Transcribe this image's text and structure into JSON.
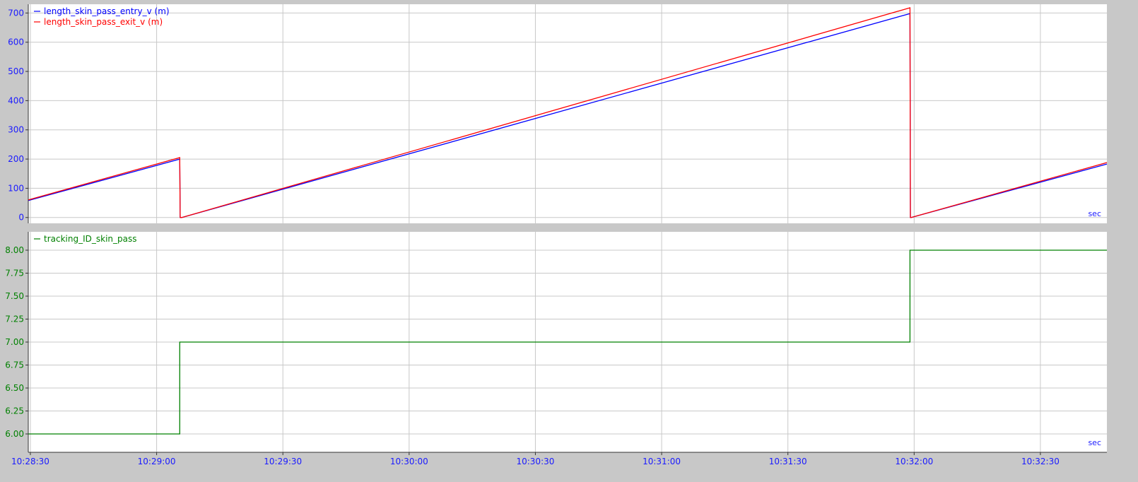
{
  "colors": {
    "background": "#c8c8c8",
    "plot_bg": "#ffffff",
    "grid": "#c8c8c8",
    "axis_text": "#1a1aff",
    "entry_series": "#0000ff",
    "exit_series": "#ff0000",
    "tracking_series": "#008000"
  },
  "x_axis": {
    "tick_labels": [
      "10:28:30",
      "10:29:00",
      "10:29:30",
      "10:30:00",
      "10:30:30",
      "10:31:00",
      "10:31:30",
      "10:32:00",
      "10:32:30"
    ],
    "tick_seconds": [
      0,
      30,
      60,
      90,
      120,
      150,
      180,
      210,
      240
    ],
    "range_seconds": [
      -0.5,
      255.8
    ],
    "unit_label": "sec"
  },
  "chart_data": [
    {
      "type": "line",
      "ylim": [
        -20,
        730
      ],
      "yticks": [
        0,
        100,
        200,
        300,
        400,
        500,
        600,
        700
      ],
      "ytick_labels": [
        "0",
        "100",
        "200",
        "300",
        "400",
        "500",
        "600",
        "700"
      ],
      "unit_label": "sec",
      "grid": true,
      "legend_position": "top-left",
      "series": [
        {
          "name": "length_skin_pass_entry_v (m)",
          "color": "#0000ff",
          "points": [
            [
              -0.5,
              58
            ],
            [
              35.5,
              200
            ],
            [
              35.6,
              0
            ],
            [
              36.0,
              0
            ],
            [
              209.0,
              698
            ],
            [
              209.1,
              0
            ],
            [
              209.3,
              0
            ],
            [
              255.8,
              183
            ]
          ]
        },
        {
          "name": "length_skin_pass_exit_v (m)",
          "color": "#ff0000",
          "points": [
            [
              -0.5,
              60
            ],
            [
              35.5,
              205
            ],
            [
              35.6,
              0
            ],
            [
              36.0,
              0
            ],
            [
              209.0,
              718
            ],
            [
              209.1,
              0
            ],
            [
              209.3,
              0
            ],
            [
              255.8,
              188
            ]
          ]
        }
      ]
    },
    {
      "type": "line",
      "ylim": [
        5.8,
        8.2
      ],
      "yticks": [
        6.0,
        6.25,
        6.5,
        6.75,
        7.0,
        7.25,
        7.5,
        7.75,
        8.0
      ],
      "ytick_labels": [
        "6.00",
        "6.25",
        "6.50",
        "6.75",
        "7.00",
        "7.25",
        "7.50",
        "7.75",
        "8.00"
      ],
      "unit_label": "sec",
      "grid": true,
      "legend_position": "top-left",
      "series": [
        {
          "name": "tracking_ID_skin_pass",
          "color": "#008000",
          "points": [
            [
              -0.5,
              6.0
            ],
            [
              35.5,
              6.0
            ],
            [
              35.5,
              7.0
            ],
            [
              209.0,
              7.0
            ],
            [
              209.0,
              8.0
            ],
            [
              255.8,
              8.0
            ]
          ]
        }
      ]
    }
  ]
}
